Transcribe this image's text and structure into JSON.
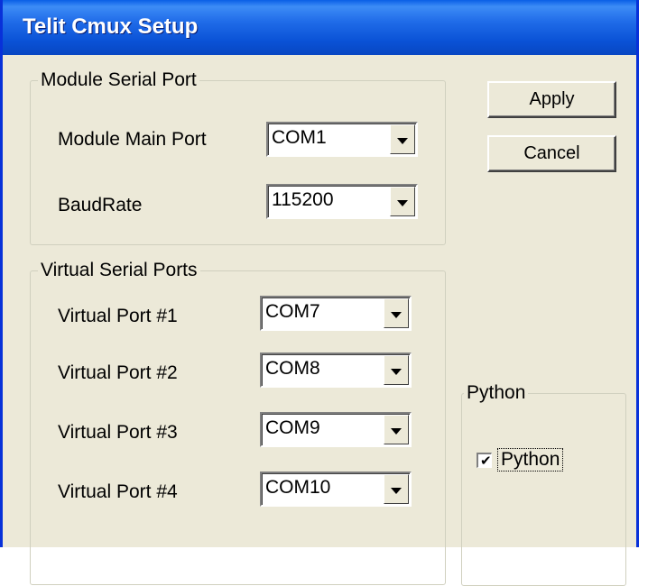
{
  "window": {
    "title": "Telit Cmux Setup"
  },
  "module_serial_port": {
    "title": "Module Serial Port",
    "main_port": {
      "label": "Module Main Port",
      "value": "COM1"
    },
    "baud_rate": {
      "label": "BaudRate",
      "value": "115200"
    }
  },
  "virtual_serial_ports": {
    "title": "Virtual Serial Ports",
    "ports": [
      {
        "label": "Virtual Port #1",
        "value": "COM7"
      },
      {
        "label": "Virtual Port #2",
        "value": "COM8"
      },
      {
        "label": "Virtual Port #3",
        "value": "COM9"
      },
      {
        "label": "Virtual Port #4",
        "value": "COM10"
      }
    ]
  },
  "buttons": {
    "apply": "Apply",
    "cancel": "Cancel"
  },
  "python": {
    "title": "Python",
    "checkbox_label": "Python",
    "checked": true,
    "check_glyph": "✔"
  },
  "colors": {
    "titlebar": "#0a52d6",
    "dialog_bg": "#ece9d8"
  }
}
